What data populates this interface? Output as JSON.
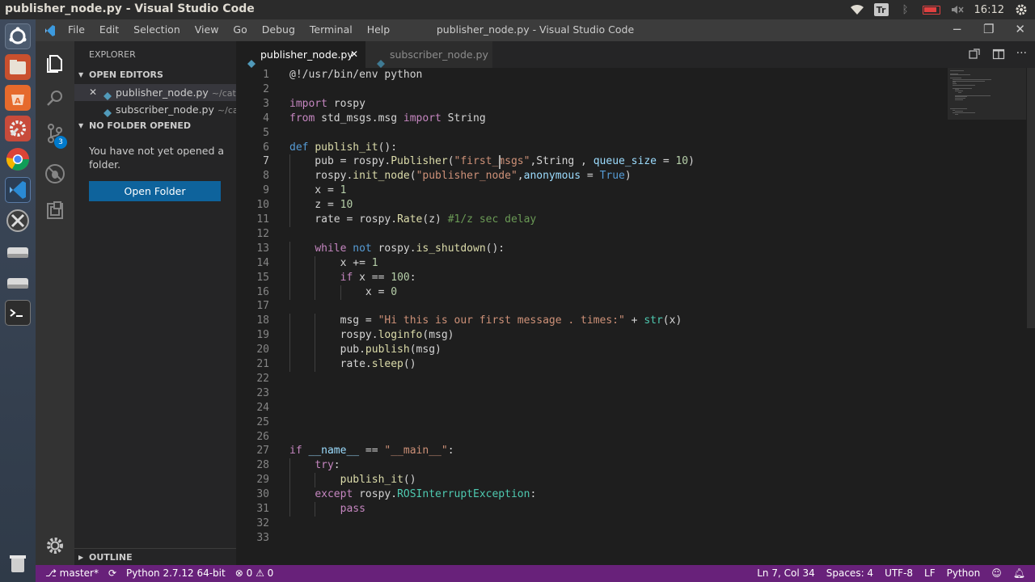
{
  "os_topbar": {
    "window_title": "publisher_node.py - Visual Studio Code",
    "keyboard_indicator": "Tr",
    "clock": "16:12"
  },
  "menubar": {
    "items": [
      "File",
      "Edit",
      "Selection",
      "View",
      "Go",
      "Debug",
      "Terminal",
      "Help"
    ],
    "title": "publisher_node.py - Visual Studio Code"
  },
  "activity_bar": {
    "source_control_badge": "3"
  },
  "sidebar": {
    "header": "EXPLORER",
    "open_editors_title": "OPEN EDITORS",
    "open_editors": [
      {
        "name": "publisher_node.py",
        "path": "~/cat..."
      },
      {
        "name": "subscriber_node.py",
        "path": "~/ca..."
      }
    ],
    "no_folder_title": "NO FOLDER OPENED",
    "no_folder_message": "You have not yet opened a folder.",
    "open_folder_button": "Open Folder",
    "outline_title": "OUTLINE"
  },
  "tabs": [
    {
      "label": "publisher_node.py",
      "active": true
    },
    {
      "label": "subscriber_node.py",
      "active": false
    }
  ],
  "editor": {
    "current_line": 7,
    "lines": [
      [
        [
          "",
          "@!/usr/bin/env python"
        ]
      ],
      [],
      [
        [
          "kw",
          "import"
        ],
        [
          "",
          " rospy"
        ]
      ],
      [
        [
          "kw",
          "from"
        ],
        [
          "",
          " std_msgs.msg "
        ],
        [
          "kw",
          "import"
        ],
        [
          "",
          " String"
        ]
      ],
      [],
      [
        [
          "kb",
          "def"
        ],
        [
          "",
          " "
        ],
        [
          "fn",
          "publish_it"
        ],
        [
          "",
          "():"
        ]
      ],
      [
        [
          "",
          "    pub = rospy."
        ],
        [
          "fn",
          "Publisher"
        ],
        [
          "",
          "("
        ],
        [
          "st",
          "\"first_msgs\""
        ],
        [
          "",
          ",String , "
        ],
        [
          "pa",
          "queue_size"
        ],
        [
          "",
          " = "
        ],
        [
          "nu",
          "10"
        ],
        [
          "",
          ")"
        ]
      ],
      [
        [
          "",
          "    rospy."
        ],
        [
          "fn",
          "init_node"
        ],
        [
          "",
          "("
        ],
        [
          "st",
          "\"publisher_node\""
        ],
        [
          "",
          ","
        ],
        [
          "pa",
          "anonymous"
        ],
        [
          "",
          " = "
        ],
        [
          "kb",
          "True"
        ],
        [
          "",
          ")"
        ]
      ],
      [
        [
          "",
          "    x = "
        ],
        [
          "nu",
          "1"
        ]
      ],
      [
        [
          "",
          "    z = "
        ],
        [
          "nu",
          "10"
        ]
      ],
      [
        [
          "",
          "    rate = rospy."
        ],
        [
          "fn",
          "Rate"
        ],
        [
          "",
          "(z) "
        ],
        [
          "cm",
          "#1/z sec delay"
        ]
      ],
      [],
      [
        [
          "",
          "    "
        ],
        [
          "kw",
          "while"
        ],
        [
          "",
          " "
        ],
        [
          "kb",
          "not"
        ],
        [
          "",
          " rospy."
        ],
        [
          "fn",
          "is_shutdown"
        ],
        [
          "",
          "():"
        ]
      ],
      [
        [
          "",
          "        x += "
        ],
        [
          "nu",
          "1"
        ]
      ],
      [
        [
          "",
          "        "
        ],
        [
          "kw",
          "if"
        ],
        [
          "",
          " x == "
        ],
        [
          "nu",
          "100"
        ],
        [
          "",
          ":"
        ]
      ],
      [
        [
          "",
          "            x = "
        ],
        [
          "nu",
          "0"
        ]
      ],
      [],
      [
        [
          "",
          "        msg = "
        ],
        [
          "st",
          "\"Hi this is our first message . times:\""
        ],
        [
          "",
          " + "
        ],
        [
          "bi",
          "str"
        ],
        [
          "",
          "(x)"
        ]
      ],
      [
        [
          "",
          "        rospy."
        ],
        [
          "fn",
          "loginfo"
        ],
        [
          "",
          "(msg)"
        ]
      ],
      [
        [
          "",
          "        pub."
        ],
        [
          "fn",
          "publish"
        ],
        [
          "",
          "(msg)"
        ]
      ],
      [
        [
          "",
          "        rate."
        ],
        [
          "fn",
          "sleep"
        ],
        [
          "",
          "()"
        ]
      ],
      [],
      [],
      [],
      [],
      [],
      [
        [
          "kw",
          "if"
        ],
        [
          "",
          " "
        ],
        [
          "pa",
          "__name__"
        ],
        [
          "",
          " == "
        ],
        [
          "st",
          "\"__main__\""
        ],
        [
          "",
          ":"
        ]
      ],
      [
        [
          "",
          "    "
        ],
        [
          "kw",
          "try"
        ],
        [
          "",
          ":"
        ]
      ],
      [
        [
          "",
          "        "
        ],
        [
          "fn",
          "publish_it"
        ],
        [
          "",
          "()"
        ]
      ],
      [
        [
          "",
          "    "
        ],
        [
          "kw",
          "except"
        ],
        [
          "",
          " rospy."
        ],
        [
          "bi",
          "ROSInterruptException"
        ],
        [
          "",
          ":"
        ]
      ],
      [
        [
          "",
          "        "
        ],
        [
          "kw",
          "pass"
        ]
      ],
      [],
      []
    ]
  },
  "status_bar": {
    "branch": "master*",
    "interpreter": "Python 2.7.12 64-bit",
    "errors": "0",
    "warnings": "0",
    "position": "Ln 7, Col 34",
    "spaces": "Spaces: 4",
    "encoding": "UTF-8",
    "eol": "LF",
    "language": "Python"
  },
  "colors": {
    "status_bar": "#68217a",
    "accent": "#007acc",
    "button": "#0e639c"
  }
}
